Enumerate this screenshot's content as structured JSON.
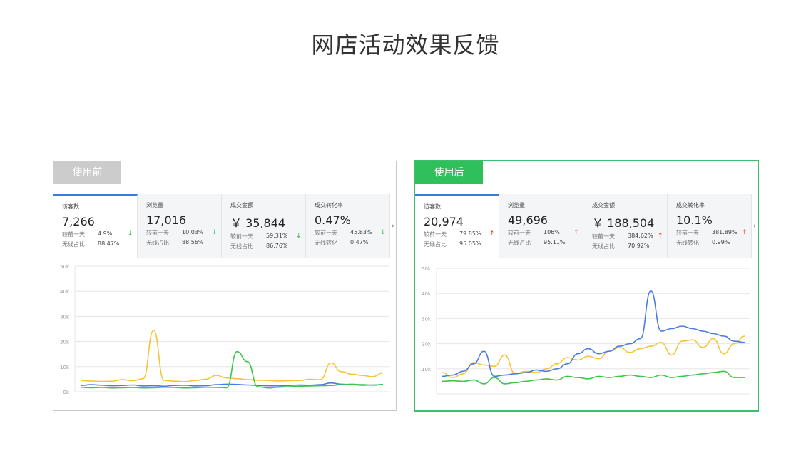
{
  "page": {
    "title": "网店活动效果反馈"
  },
  "before": {
    "tag": "使用前",
    "metrics": [
      {
        "label": "访客数",
        "value": "7,266",
        "r1k": "较前一天",
        "r1v": "4.9%",
        "r1a": "↓",
        "r2k": "无线占比",
        "r2v": "88.47%"
      },
      {
        "label": "浏览量",
        "value": "17,016",
        "r1k": "较前一天",
        "r1v": "10.03%",
        "r1a": "↓",
        "r2k": "无线占比",
        "r2v": "88.56%"
      },
      {
        "label": "成交金额",
        "value": "￥ 35,844",
        "r1k": "较前一天",
        "r1v": "59.31%",
        "r1a": "↓",
        "r2k": "无线占比",
        "r2v": "86.76%"
      },
      {
        "label": "成交转化率",
        "value": "0.47%",
        "r1k": "较前一天",
        "r1v": "45.83%",
        "r1a": "↓",
        "r2k": "无线转化",
        "r2v": "0.47%"
      }
    ],
    "more": "›"
  },
  "after": {
    "tag": "使用后",
    "metrics": [
      {
        "label": "访客数",
        "value": "20,974",
        "r1k": "较前一天",
        "r1v": "79.85%",
        "r1a": "↑",
        "r2k": "无线占比",
        "r2v": "95.05%"
      },
      {
        "label": "浏览量",
        "value": "49,696",
        "r1k": "较前一天",
        "r1v": "106%",
        "r1a": "↑",
        "r2k": "无线占比",
        "r2v": "95.11%"
      },
      {
        "label": "成交金额",
        "value": "￥ 188,504",
        "r1k": "较前一天",
        "r1v": "384.62%",
        "r1a": "↑",
        "r2k": "无线占比",
        "r2v": "70.92%"
      },
      {
        "label": "成交转化率",
        "value": "10.1%",
        "r1k": "较前一天",
        "r1v": "381.89%",
        "r1a": "↑",
        "r2k": "无线转化",
        "r2v": "0.99%"
      }
    ],
    "more": "›"
  },
  "colors": {
    "blue": "#4a7be0",
    "yellow": "#f5c438",
    "green": "#3cc64a",
    "grid": "#e6e6e6",
    "axis_text": "#999999"
  },
  "chart_data": [
    {
      "type": "line",
      "ylim": [
        0,
        50000
      ],
      "yticks": [
        "0k",
        "10k",
        "20k",
        "30k",
        "40k",
        "50k"
      ],
      "grid": true,
      "series": [
        {
          "color": "yellow",
          "values": [
            4500,
            4300,
            4100,
            4200,
            4800,
            4400,
            5200,
            24500,
            4500,
            4200,
            4000,
            4500,
            5000,
            6500,
            5500,
            5200,
            4800,
            4600,
            4500,
            4300,
            4400,
            4500,
            5000,
            4800,
            11500,
            8000,
            7000,
            6500,
            6000,
            7500
          ]
        },
        {
          "color": "blue",
          "values": [
            2500,
            2800,
            2600,
            2400,
            2500,
            2700,
            2300,
            2400,
            2200,
            2500,
            2600,
            2300,
            2400,
            2800,
            3000,
            2900,
            2700,
            2500,
            2400,
            2300,
            2500,
            2700,
            2600,
            2800,
            3500,
            3000,
            2800,
            2600,
            2700,
            2800
          ]
        },
        {
          "color": "green",
          "values": [
            1800,
            1600,
            1700,
            1500,
            1600,
            1700,
            1500,
            1600,
            1800,
            1700,
            1500,
            1600,
            1800,
            1700,
            1600,
            16000,
            12000,
            2000,
            1500,
            1800,
            2000,
            2200,
            2300,
            2400,
            2500,
            2800,
            3000,
            2800,
            2600,
            2900
          ]
        }
      ]
    },
    {
      "type": "line",
      "ylim": [
        0,
        50000
      ],
      "yticks": [
        "",
        "10k",
        "20k",
        "30k",
        "40k",
        "50k"
      ],
      "grid": true,
      "series": [
        {
          "color": "yellow",
          "values": [
            8500,
            6500,
            8000,
            12500,
            11500,
            11000,
            15500,
            8000,
            9000,
            8500,
            10000,
            12000,
            14500,
            13500,
            15000,
            14000,
            17000,
            18500,
            16500,
            18000,
            19000,
            20500,
            15500,
            21000,
            21500,
            18500,
            22000,
            16000,
            20000,
            23000
          ]
        },
        {
          "color": "blue",
          "values": [
            7000,
            7500,
            9000,
            12000,
            17000,
            7000,
            7500,
            8000,
            8500,
            9500,
            9000,
            10000,
            12000,
            16000,
            18000,
            16000,
            17000,
            19000,
            20000,
            22000,
            41000,
            25000,
            26000,
            27000,
            26000,
            25000,
            24000,
            23000,
            21000,
            20500
          ]
        },
        {
          "color": "green",
          "values": [
            5000,
            5200,
            5000,
            5500,
            4000,
            6500,
            4000,
            4500,
            5000,
            5500,
            6000,
            5500,
            7000,
            6500,
            6000,
            7000,
            6500,
            7000,
            7500,
            7000,
            6500,
            7500,
            6500,
            7000,
            7500,
            8000,
            8500,
            9000,
            6500,
            6500
          ]
        }
      ]
    }
  ]
}
